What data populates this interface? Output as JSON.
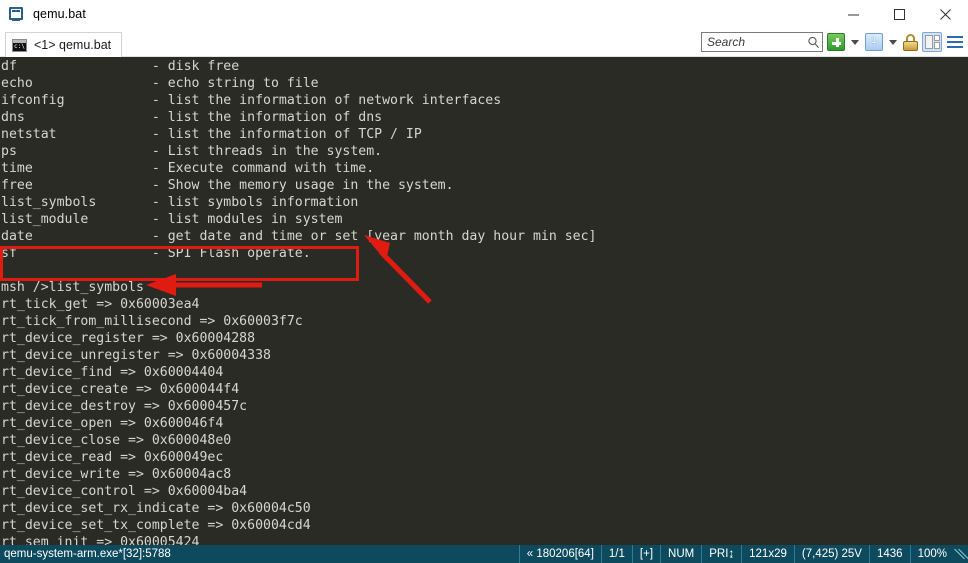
{
  "window": {
    "title": "qemu.bat",
    "icon": "console-app-icon",
    "minimize_label": "Minimize",
    "maximize_label": "Maximize",
    "close_label": "Close"
  },
  "tab": {
    "label": "<1> qemu.bat",
    "icon": "console-icon"
  },
  "toolbar": {
    "search_placeholder": "Search",
    "search_value": "",
    "new_tab_label": "New",
    "new_tab_dropdown_label": "New tab options",
    "window_selector_label": "1",
    "window_dropdown_label": "Window list",
    "lock_label": "Lock",
    "panel_toggle_label": "Toggle panel",
    "menu_label": "Menu"
  },
  "terminal": {
    "background": "#2b2b26",
    "foreground": "#d6d6cf",
    "lines": [
      "df                 - disk free",
      "echo               - echo string to file",
      "ifconfig           - list the information of network interfaces",
      "dns                - list the information of dns",
      "netstat            - list the information of TCP / IP",
      "ps                 - List threads in the system.",
      "time               - Execute command with time.",
      "free               - Show the memory usage in the system.",
      "list_symbols       - list symbols information",
      "list_module        - list modules in system",
      "date               - get date and time or set [year month day hour min sec]",
      "sf                 - SPI Flash operate.",
      "",
      "msh />list_symbols",
      "rt_tick_get => 0x60003ea4",
      "rt_tick_from_millisecond => 0x60003f7c",
      "rt_device_register => 0x60004288",
      "rt_device_unregister => 0x60004338",
      "rt_device_find => 0x60004404",
      "rt_device_create => 0x600044f4",
      "rt_device_destroy => 0x6000457c",
      "rt_device_open => 0x600046f4",
      "rt_device_close => 0x600048e0",
      "rt_device_read => 0x600049ec",
      "rt_device_write => 0x60004ac8",
      "rt_device_control => 0x60004ba4",
      "rt_device_set_rx_indicate => 0x60004c50",
      "rt_device_set_tx_complete => 0x60004cd4",
      "rt_sem_init => 0x60005424"
    ]
  },
  "annotations": {
    "color": "#e01b12",
    "highlight_rect_label": "highlight-list-commands",
    "arrow_left_label": "arrow-pointing-to-command",
    "arrow_diagonal_label": "arrow-pointing-to-date-row"
  },
  "statusbar": {
    "process": "qemu-system-arm.exe*[32]:5788",
    "cells": [
      "« 180206[64]",
      "1/1",
      "[+]",
      "NUM",
      "PRI↨",
      "121x29",
      "(7,425) 25V",
      "1436",
      "100%"
    ]
  }
}
